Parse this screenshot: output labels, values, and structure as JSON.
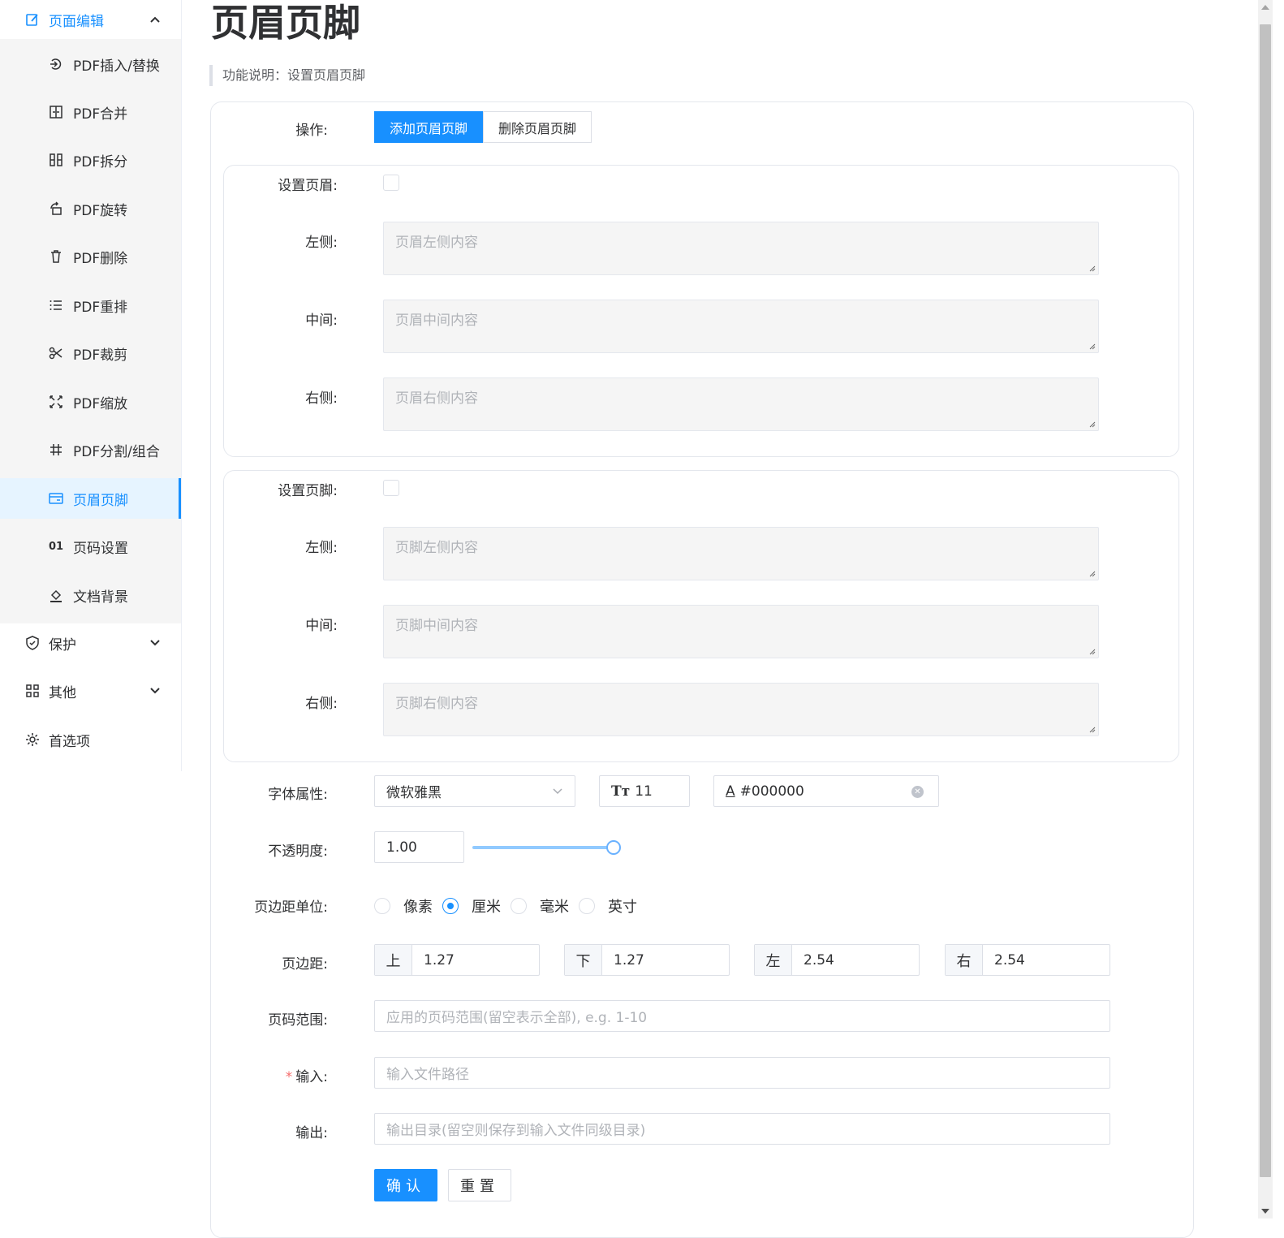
{
  "sidebar": {
    "group_page_edit": "页面编辑",
    "items": [
      {
        "label": "PDF插入/替换"
      },
      {
        "label": "PDF合并"
      },
      {
        "label": "PDF拆分"
      },
      {
        "label": "PDF旋转"
      },
      {
        "label": "PDF删除"
      },
      {
        "label": "PDF重排"
      },
      {
        "label": "PDF裁剪"
      },
      {
        "label": "PDF缩放"
      },
      {
        "label": "PDF分割/组合"
      },
      {
        "label": "页眉页脚"
      },
      {
        "label": "页码设置",
        "icon_text": "01"
      },
      {
        "label": "文档背景"
      }
    ],
    "group_protect": "保护",
    "group_other": "其他",
    "group_prefs": "首选项",
    "accent_color": "#1890ff"
  },
  "main": {
    "title": "页眉页脚",
    "description": "功能说明：设置页眉页脚"
  },
  "form": {
    "operation_label": "操作:",
    "op_add": "添加页眉页脚",
    "op_delete": "删除页眉页脚",
    "header": {
      "toggle_label": "设置页眉:",
      "left_label": "左侧:",
      "center_label": "中间:",
      "right_label": "右侧:",
      "left_placeholder": "页眉左侧内容",
      "center_placeholder": "页眉中间内容",
      "right_placeholder": "页眉右侧内容"
    },
    "footer": {
      "toggle_label": "设置页脚:",
      "left_label": "左侧:",
      "center_label": "中间:",
      "right_label": "右侧:",
      "left_placeholder": "页脚左侧内容",
      "center_placeholder": "页脚中间内容",
      "right_placeholder": "页脚右侧内容"
    },
    "font_label": "字体属性:",
    "font_family": "微软雅黑",
    "font_size": "11",
    "font_color": "#000000",
    "opacity_label": "不透明度:",
    "opacity_value": "1.00",
    "opacity_fraction": 1.0,
    "unit_label": "页边距单位:",
    "units": [
      "像素",
      "厘米",
      "毫米",
      "英寸"
    ],
    "unit_selected": "厘米",
    "margin_label": "页边距:",
    "margins": [
      {
        "prefix": "上",
        "value": "1.27"
      },
      {
        "prefix": "下",
        "value": "1.27"
      },
      {
        "prefix": "左",
        "value": "2.54"
      },
      {
        "prefix": "右",
        "value": "2.54"
      }
    ],
    "range_label": "页码范围:",
    "range_placeholder": "应用的页码范围(留空表示全部), e.g. 1-10",
    "input_required_mark": "*",
    "input_label": "输入:",
    "input_placeholder": "输入文件路径",
    "output_label": "输出:",
    "output_placeholder": "输出目录(留空则保存到输入文件同级目录)",
    "confirm": "确认",
    "reset": "重置"
  }
}
